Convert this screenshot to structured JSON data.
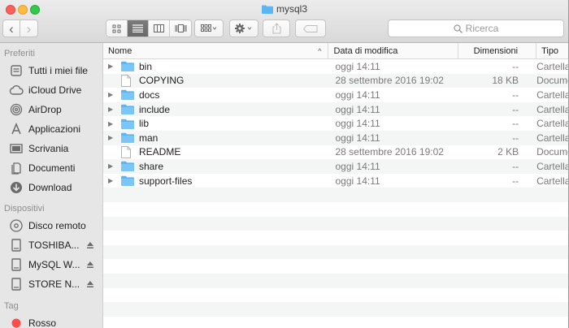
{
  "window": {
    "title": "mysql3"
  },
  "toolbar": {
    "back": "‹",
    "forward": "›",
    "search_placeholder": "Ricerca"
  },
  "sidebar": {
    "favorites_header": "Preferiti",
    "favorites": [
      {
        "label": "Tutti i miei file",
        "icon": "all-files-icon"
      },
      {
        "label": "iCloud Drive",
        "icon": "cloud-icon"
      },
      {
        "label": "AirDrop",
        "icon": "airdrop-icon"
      },
      {
        "label": "Applicazioni",
        "icon": "applications-icon"
      },
      {
        "label": "Scrivania",
        "icon": "desktop-icon"
      },
      {
        "label": "Documenti",
        "icon": "documents-icon"
      },
      {
        "label": "Download",
        "icon": "download-icon"
      }
    ],
    "devices_header": "Dispositivi",
    "devices": [
      {
        "label": "Disco remoto",
        "icon": "remote-disc-icon"
      },
      {
        "label": "TOSHIBA...",
        "icon": "drive-icon"
      },
      {
        "label": "MySQL W...",
        "icon": "drive-icon"
      },
      {
        "label": "STORE N...",
        "icon": "drive-icon"
      }
    ],
    "tags_header": "Tag",
    "tags": [
      {
        "label": "Rosso",
        "color": "#fc4d47"
      }
    ]
  },
  "columns": {
    "name": "Nome",
    "date": "Data di modifica",
    "size": "Dimensioni",
    "type": "Tipo"
  },
  "files": [
    {
      "name": "bin",
      "date": "oggi 14:11",
      "size": "--",
      "type": "Cartella",
      "folder": true
    },
    {
      "name": "COPYING",
      "date": "28 settembre 2016 19:02",
      "size": "18 KB",
      "type": "Documento",
      "folder": false
    },
    {
      "name": "docs",
      "date": "oggi 14:11",
      "size": "--",
      "type": "Cartella",
      "folder": true
    },
    {
      "name": "include",
      "date": "oggi 14:11",
      "size": "--",
      "type": "Cartella",
      "folder": true
    },
    {
      "name": "lib",
      "date": "oggi 14:11",
      "size": "--",
      "type": "Cartella",
      "folder": true
    },
    {
      "name": "man",
      "date": "oggi 14:11",
      "size": "--",
      "type": "Cartella",
      "folder": true
    },
    {
      "name": "README",
      "date": "28 settembre 2016 19:02",
      "size": "2 KB",
      "type": "Documento",
      "folder": false
    },
    {
      "name": "share",
      "date": "oggi 14:11",
      "size": "--",
      "type": "Cartella",
      "folder": true
    },
    {
      "name": "support-files",
      "date": "oggi 14:11",
      "size": "--",
      "type": "Cartella",
      "folder": true
    }
  ],
  "colors": {
    "folder": "#5ab6f2",
    "selected_view": "#6e6e6e"
  }
}
